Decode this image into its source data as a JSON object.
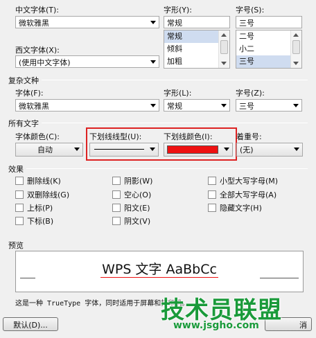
{
  "chinese_font": {
    "label": "中文字体(T):",
    "value": "微软雅黑"
  },
  "font_style": {
    "label": "字形(Y):",
    "value": "常规",
    "options": [
      "常规",
      "倾斜",
      "加粗"
    ],
    "selected": "常规"
  },
  "font_size": {
    "label": "字号(S):",
    "value": "三号",
    "options": [
      "二号",
      "小二",
      "三号"
    ],
    "selected": "三号"
  },
  "western_font": {
    "label": "西文字体(X):",
    "value": "(使用中文字体)"
  },
  "complex_script": {
    "title": "复杂文种",
    "font_label": "字体(F):",
    "font_value": "微软雅黑",
    "style_label": "字形(L):",
    "style_value": "常规",
    "size_label": "字号(Z):",
    "size_value": "三号"
  },
  "all_text": {
    "title": "所有文字",
    "font_color_label": "字体颜色(C):",
    "font_color_value": "自动",
    "underline_type_label": "下划线线型(U):",
    "underline_color_label": "下划线颜色(I):",
    "underline_color": "#ee1111",
    "emphasis_label": "着重号:",
    "emphasis_value": "(无)"
  },
  "effects": {
    "title": "效果",
    "items": [
      {
        "label": "删除线(K)"
      },
      {
        "label": "双删除线(G)"
      },
      {
        "label": "上标(P)"
      },
      {
        "label": "下标(B)"
      },
      {
        "label": "阴影(W)"
      },
      {
        "label": "空心(O)"
      },
      {
        "label": "阳文(E)"
      },
      {
        "label": "阴文(V)"
      },
      {
        "label": "小型大写字母(M)"
      },
      {
        "label": "全部大写字母(A)"
      },
      {
        "label": "隐藏文字(H)"
      }
    ]
  },
  "preview": {
    "title": "预览",
    "sample": "WPS 文字 AaBbCc",
    "description": "这是一种 TrueType 字体，同时适用于屏幕和打印机。"
  },
  "buttons": {
    "default": "默认(D)...",
    "cancel": "消"
  },
  "watermark": {
    "title": "技术员联盟",
    "url": "www.jsgho.com"
  }
}
